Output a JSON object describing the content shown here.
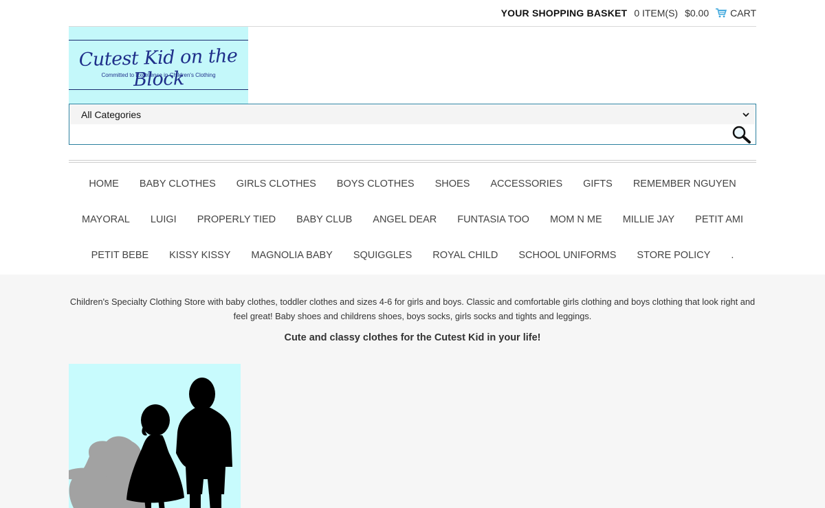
{
  "header": {
    "basket_label": "YOUR SHOPPING BASKET",
    "items": "0 ITEM(S)",
    "total": "$0.00",
    "cart_label": "CART",
    "accent_color": "#3aa5dc"
  },
  "logo": {
    "brand": "Cutest Kid on the Block",
    "tagline": "Committed to Excellence in Children's Clothing",
    "background": "#c4f8fa"
  },
  "search": {
    "category_selected": "All Categories",
    "input_value": "",
    "button_icon": "magnifier-icon"
  },
  "nav": {
    "rows": [
      [
        "HOME",
        "BABY CLOTHES",
        "GIRLS CLOTHES",
        "BOYS CLOTHES",
        "SHOES",
        "ACCESSORIES",
        "GIFTS",
        "REMEMBER NGUYEN"
      ],
      [
        "MAYORAL",
        "LUIGI",
        "PROPERLY TIED",
        "BABY CLUB",
        "ANGEL DEAR",
        "FUNTASIA TOO",
        "MOM N ME",
        "MILLIE JAY",
        "PETIT AMI"
      ],
      [
        "PETIT BEBE",
        "KISSY KISSY",
        "MAGNOLIA BABY",
        "SQUIGGLES",
        "ROYAL CHILD",
        "SCHOOL UNIFORMS",
        "STORE POLICY",
        "."
      ]
    ]
  },
  "content": {
    "description": "Children's Specialty Clothing Store with baby clothes, toddler clothes and sizes 4-6 for girls and boys. Classic and comfortable girls clothing and boys clothing that look right and feel great! Baby shoes and childrens shoes, boys socks, girls socks and tights and leggings.",
    "tagline": "Cute and classy clothes for the Cutest Kid in your life!"
  }
}
